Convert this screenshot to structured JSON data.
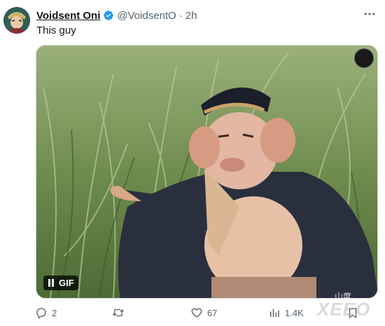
{
  "tweet": {
    "display_name": "Voidsent Oni",
    "handle": "@VoidsentO",
    "separator": "·",
    "time": "2h",
    "text": "This guy"
  },
  "media": {
    "type_label": "GIF",
    "watermark_text": "山度"
  },
  "actions": {
    "replies": "2",
    "retweets": "",
    "likes": "67",
    "views": "1.4K"
  },
  "overlay_watermark": "XEEO",
  "colors": {
    "verified": "#1d9bf0",
    "muted": "#536471",
    "text": "#0f1419"
  },
  "icons": [
    "verified-icon",
    "more-icon",
    "pause-icon",
    "reply-icon",
    "retweet-icon",
    "like-icon",
    "views-icon",
    "bookmark-icon"
  ]
}
